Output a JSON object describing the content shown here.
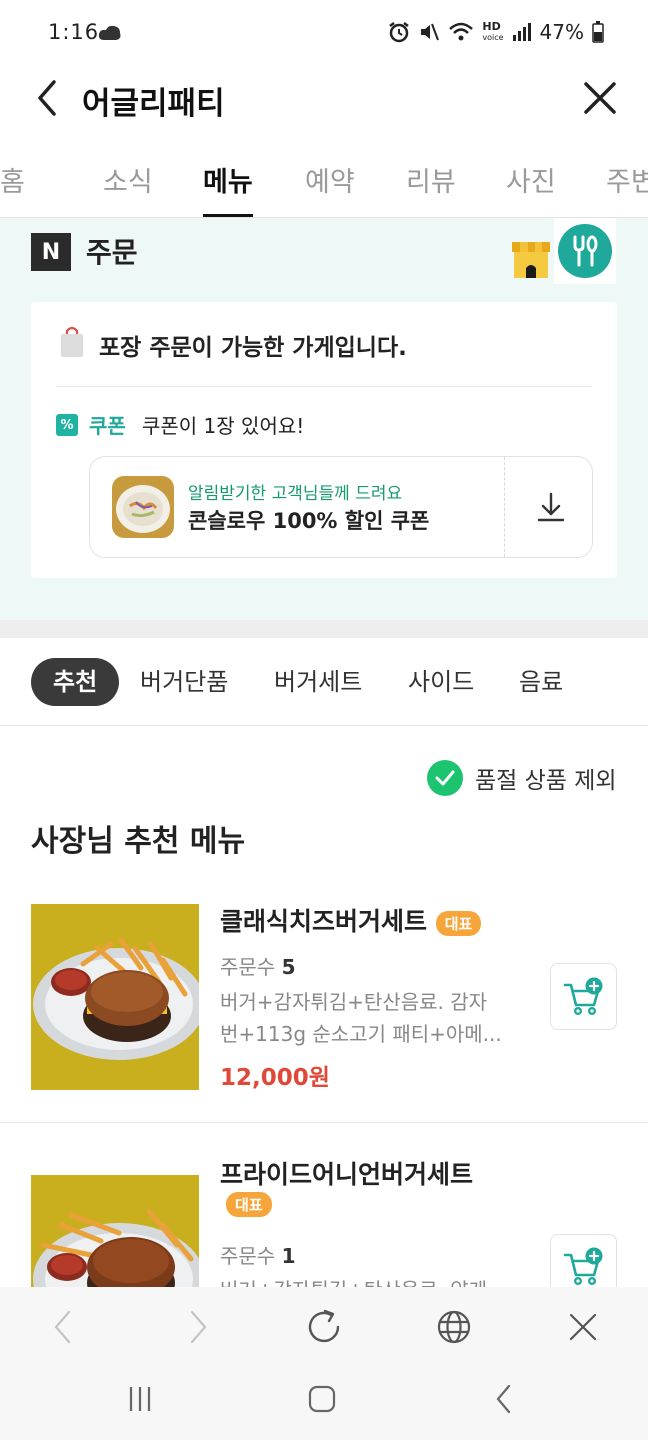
{
  "status": {
    "time": "1:16",
    "battery": "47%"
  },
  "header": {
    "title": "어글리패티"
  },
  "tabs": [
    {
      "label": "홈"
    },
    {
      "label": "소식"
    },
    {
      "label": "메뉴"
    },
    {
      "label": "예약"
    },
    {
      "label": "리뷰"
    },
    {
      "label": "사진"
    },
    {
      "label": "주변"
    }
  ],
  "order": {
    "logo_letter": "N",
    "title": "주문",
    "takeout_text": "포장 주문이 가능한 가게입니다.",
    "coupon_badge": "%",
    "coupon_label": "쿠폰",
    "coupon_count_text": "쿠폰이 1장 있어요!",
    "coupon_sub": "알림받기한 고객님들께 드려요",
    "coupon_name": "콘슬로우 100% 할인 쿠폰"
  },
  "categories": [
    {
      "label": "추천"
    },
    {
      "label": "버거단품"
    },
    {
      "label": "버거세트"
    },
    {
      "label": "사이드"
    },
    {
      "label": "음료"
    }
  ],
  "menu": {
    "soldout_filter": "품절 상품 제외",
    "heading": "사장님 추천 메뉴",
    "items": [
      {
        "name": "클래식치즈버거세트",
        "badge": "대표",
        "orders_label": "주문수",
        "orders": "5",
        "desc_line1": "버거+감자튀김+탄산음료. 감자",
        "desc_line2": "번+113g 순소고기 패티+아메...",
        "price": "12,000원"
      },
      {
        "name": "프라이드어니언버거세트",
        "badge": "대표",
        "orders_label": "주문수",
        "orders": "1",
        "desc_line1": "버거+감자튀김+탄산음료. 양게",
        "desc_line2": "",
        "price": ""
      }
    ]
  },
  "colors": {
    "accent_teal": "#1fa99a",
    "badge_orange": "#f5a53a",
    "price_red": "#e0483a",
    "check_green": "#1dc46f"
  }
}
